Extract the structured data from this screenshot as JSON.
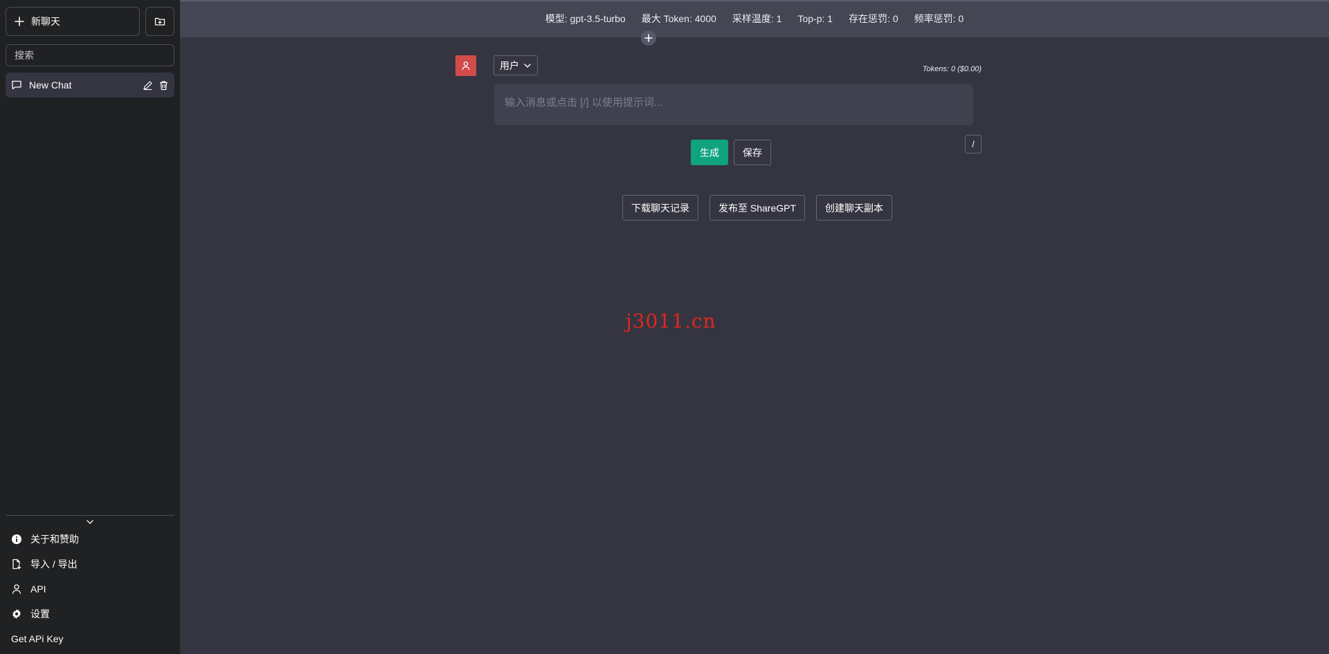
{
  "sidebar": {
    "new_chat_label": "新聊天",
    "search_placeholder": "搜索",
    "chats": [
      {
        "title": "New Chat"
      }
    ],
    "menu": {
      "about_label": "关于和赞助",
      "import_export_label": "导入 / 导出",
      "api_label": "API",
      "settings_label": "设置",
      "get_key_label": "Get APi Key"
    }
  },
  "config": {
    "model": "模型: gpt-3.5-turbo",
    "max_tokens": "最大 Token: 4000",
    "temperature": "采样温度: 1",
    "top_p": "Top-p: 1",
    "presence_penalty": "存在惩罚: 0",
    "frequency_penalty": "频率惩罚: 0"
  },
  "message": {
    "role": "用户",
    "tokens": "Tokens: 0 ($0.00)",
    "input_placeholder": "输入消息或点击 [/] 以使用提示词...",
    "slash_label": "/",
    "generate_label": "生成",
    "save_label": "保存"
  },
  "actions": {
    "download_label": "下载聊天记录",
    "share_label": "发布至 ShareGPT",
    "clone_label": "创建聊天副本"
  },
  "watermark": "j3011.cn",
  "colors": {
    "sidebar_bg": "#202123",
    "main_bg": "#343541",
    "config_bg": "#444654",
    "accent": "#10a37f",
    "avatar": "#d14b4b",
    "watermark": "#e0271f"
  }
}
